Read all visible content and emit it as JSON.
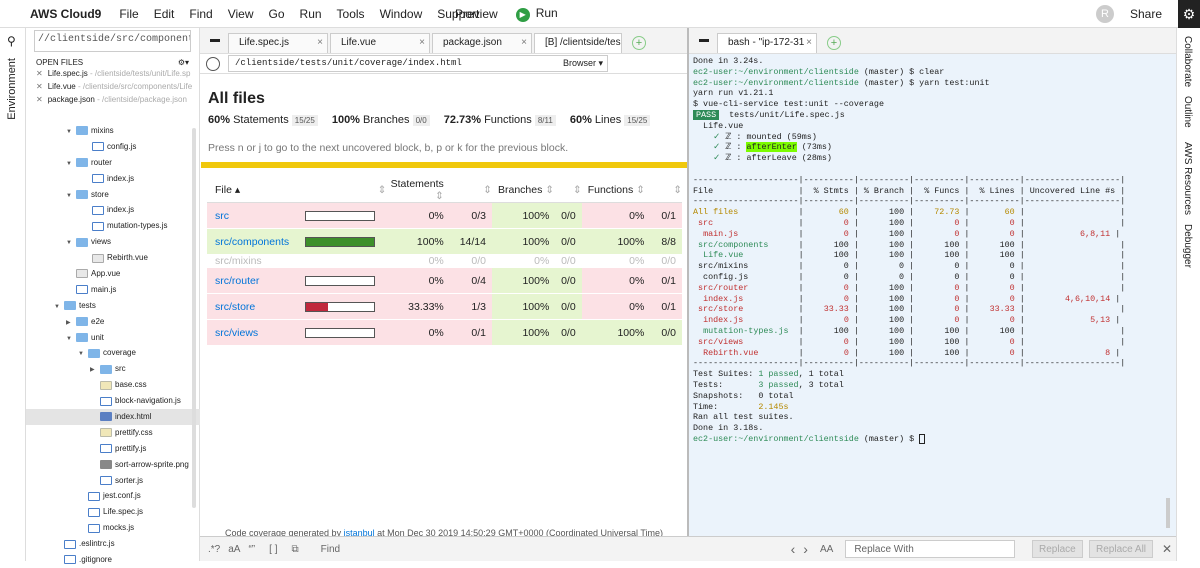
{
  "topbar": {
    "brand": "AWS Cloud9",
    "menu": [
      "File",
      "Edit",
      "Find",
      "View",
      "Go",
      "Run",
      "Tools",
      "Window",
      "Support"
    ],
    "preview": "Preview",
    "run": "Run",
    "avatar": "R",
    "share": "Share"
  },
  "leftstrip": {
    "label": "Environment"
  },
  "rightstrip": {
    "labels": [
      "Collaborate",
      "Outline",
      "AWS Resources",
      "Debugger"
    ]
  },
  "sidebar": {
    "search": "//clientside/src/components",
    "open_files_title": "OPEN FILES",
    "open_files": [
      {
        "name": "Life.spec.js",
        "path": " - /clientside/tests/unit/Life.sp"
      },
      {
        "name": "Life.vue",
        "path": " - /clientside/src/components/Life"
      },
      {
        "name": "package.json",
        "path": " - /clientside/package.json"
      }
    ],
    "tree": [
      {
        "label": "mixins",
        "indent": 40,
        "type": "folder",
        "open": true
      },
      {
        "label": "config.js",
        "indent": 56,
        "type": "js"
      },
      {
        "label": "router",
        "indent": 40,
        "type": "folder",
        "open": true
      },
      {
        "label": "index.js",
        "indent": 56,
        "type": "js"
      },
      {
        "label": "store",
        "indent": 40,
        "type": "folder",
        "open": true
      },
      {
        "label": "index.js",
        "indent": 56,
        "type": "js"
      },
      {
        "label": "mutation-types.js",
        "indent": 56,
        "type": "js"
      },
      {
        "label": "views",
        "indent": 40,
        "type": "folder",
        "open": true
      },
      {
        "label": "Rebirth.vue",
        "indent": 56,
        "type": "vue"
      },
      {
        "label": "App.vue",
        "indent": 40,
        "type": "vue"
      },
      {
        "label": "main.js",
        "indent": 40,
        "type": "js"
      },
      {
        "label": "tests",
        "indent": 28,
        "type": "folder",
        "open": true
      },
      {
        "label": "e2e",
        "indent": 40,
        "type": "folder",
        "open": false
      },
      {
        "label": "unit",
        "indent": 40,
        "type": "folder",
        "open": true
      },
      {
        "label": "coverage",
        "indent": 52,
        "type": "folder",
        "open": true
      },
      {
        "label": "src",
        "indent": 64,
        "type": "folder",
        "open": false
      },
      {
        "label": "base.css",
        "indent": 64,
        "type": "css"
      },
      {
        "label": "block-navigation.js",
        "indent": 64,
        "type": "js"
      },
      {
        "label": "index.html",
        "indent": 64,
        "type": "html",
        "selected": true
      },
      {
        "label": "prettify.css",
        "indent": 64,
        "type": "css"
      },
      {
        "label": "prettify.js",
        "indent": 64,
        "type": "js"
      },
      {
        "label": "sort-arrow-sprite.png",
        "indent": 64,
        "type": "png"
      },
      {
        "label": "sorter.js",
        "indent": 64,
        "type": "js"
      },
      {
        "label": "jest.conf.js",
        "indent": 52,
        "type": "js"
      },
      {
        "label": "Life.spec.js",
        "indent": 52,
        "type": "js"
      },
      {
        "label": "mocks.js",
        "indent": 52,
        "type": "js"
      },
      {
        "label": ".eslintrc.js",
        "indent": 28,
        "type": "js"
      },
      {
        "label": ".gitignore",
        "indent": 28,
        "type": "js"
      }
    ]
  },
  "editor": {
    "tabs": [
      "Life.spec.js",
      "Life.vue",
      "package.json",
      "[B] /clientside/tes"
    ],
    "url": "/clientside/tests/unit/coverage/index.html",
    "browser": "Browser",
    "title": "All files",
    "summary": [
      {
        "pct": "60%",
        "label": "Statements",
        "frac": "15/25"
      },
      {
        "pct": "100%",
        "label": "Branches",
        "frac": "0/0"
      },
      {
        "pct": "72.73%",
        "label": "Functions",
        "frac": "8/11"
      },
      {
        "pct": "60%",
        "label": "Lines",
        "frac": "15/25"
      }
    ],
    "hint": "Press n or j to go to the next uncovered block, b, p or k for the previous block.",
    "headers": [
      "File",
      "Statements",
      "Branches",
      "Functions"
    ],
    "rows": [
      {
        "file": "src",
        "cls": "red",
        "bar": 0,
        "bcolor": "#c0283c",
        "stmt": "0%",
        "sf": "0/3",
        "br": "100%",
        "bf": "0/0",
        "fn": "0%",
        "ff": "0/1"
      },
      {
        "file": "src/components",
        "cls": "green",
        "bar": 1,
        "bcolor": "#3d8f2a",
        "stmt": "100%",
        "sf": "14/14",
        "br": "100%",
        "bf": "0/0",
        "fn": "100%",
        "ff": "8/8"
      },
      {
        "file": "src/mixins",
        "cls": "gray",
        "bar": 0,
        "bcolor": "#999",
        "stmt": "0%",
        "sf": "0/0",
        "br": "0%",
        "bf": "0/0",
        "fn": "0%",
        "ff": "0/0"
      },
      {
        "file": "src/router",
        "cls": "red",
        "bar": 0,
        "bcolor": "#c0283c",
        "stmt": "0%",
        "sf": "0/4",
        "br": "100%",
        "bf": "0/0",
        "fn": "0%",
        "ff": "0/1"
      },
      {
        "file": "src/store",
        "cls": "red",
        "bar": 0.3333,
        "bcolor": "#c0283c",
        "stmt": "33.33%",
        "sf": "1/3",
        "br": "100%",
        "bf": "0/0",
        "fn": "0%",
        "ff": "0/1"
      },
      {
        "file": "src/views",
        "cls": "red",
        "bar": 0,
        "bcolor": "#c0283c",
        "stmt": "0%",
        "sf": "0/1",
        "br": "100%",
        "bf": "0/0",
        "fn": "100%",
        "ff": "0/0"
      }
    ],
    "footer_pre": "Code coverage generated by ",
    "footer_link": "istanbul",
    "footer_post": " at Mon Dec 30 2019 14:50:29 GMT+0000 (Coordinated Universal Time)"
  },
  "findbar": {
    "find_placeholder": "Find",
    "replace_placeholder": "Replace With",
    "replace": "Replace",
    "replace_all": "Replace All",
    "aa": "AA"
  },
  "terminal": {
    "tab": "bash - \"ip-172-31"
  }
}
